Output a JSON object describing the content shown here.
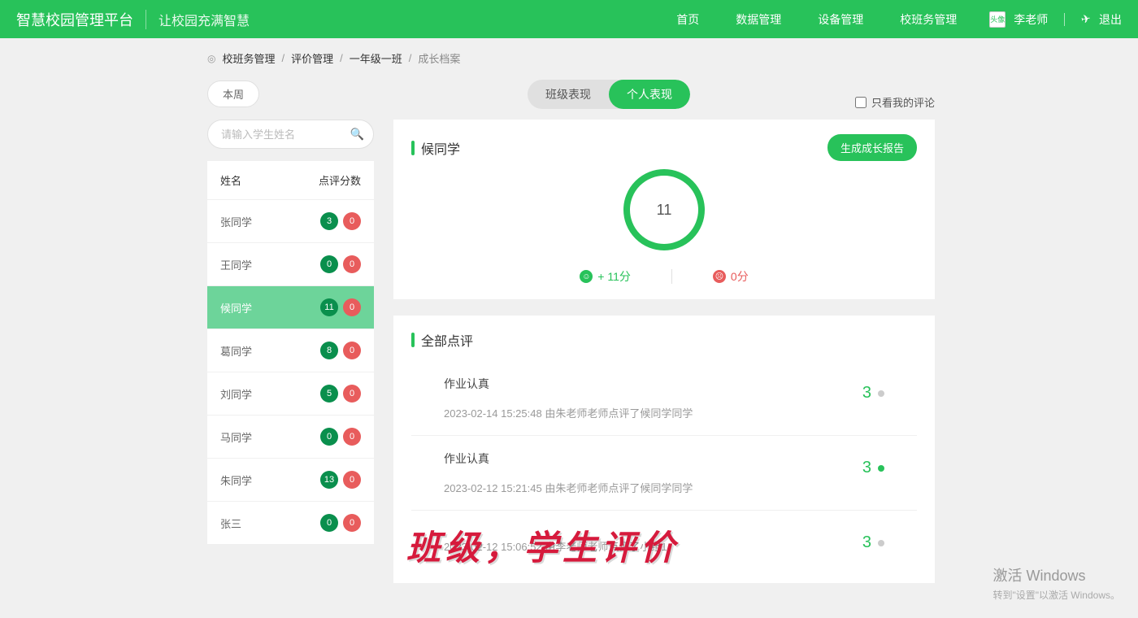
{
  "header": {
    "title": "智慧校园管理平台",
    "subtitle": "让校园充满智慧",
    "nav": {
      "home": "首页",
      "data": "数据管理",
      "device": "设备管理",
      "class": "校班务管理"
    },
    "avatar_alt": "头像",
    "username": "李老师",
    "logout": "退出"
  },
  "breadcrumb": {
    "b1": "校班务管理",
    "b2": "评价管理",
    "b3": "一年级一班",
    "b4": "成长档案"
  },
  "controls": {
    "week": "本周",
    "tab_class": "班级表现",
    "tab_person": "个人表现",
    "only_mine": "只看我的评论"
  },
  "search": {
    "placeholder": "请输入学生姓名"
  },
  "list_header": {
    "name": "姓名",
    "score": "点评分数"
  },
  "students": [
    {
      "name": "张同学",
      "pos": "3",
      "neg": "0"
    },
    {
      "name": "王同学",
      "pos": "0",
      "neg": "0"
    },
    {
      "name": "候同学",
      "pos": "11",
      "neg": "0"
    },
    {
      "name": "葛同学",
      "pos": "8",
      "neg": "0"
    },
    {
      "name": "刘同学",
      "pos": "5",
      "neg": "0"
    },
    {
      "name": "马同学",
      "pos": "0",
      "neg": "0"
    },
    {
      "name": "朱同学",
      "pos": "13",
      "neg": "0"
    },
    {
      "name": "张三",
      "pos": "0",
      "neg": "0"
    }
  ],
  "profile": {
    "name": "候同学",
    "report_btn": "生成成长报告",
    "ring_value": "11",
    "legend_pos": "+ 11分",
    "legend_neg": "0分"
  },
  "all_reviews": {
    "title": "全部点评",
    "items": [
      {
        "title": "作业认真",
        "meta": "2023-02-14 15:25:48 由朱老师老师点评了候同学同学",
        "score": "3",
        "green": false
      },
      {
        "title": "作业认真",
        "meta": "2023-02-12 15:21:45 由朱老师老师点评了候同学同学",
        "score": "3",
        "green": true
      },
      {
        "title": "",
        "meta": "2023-02-12 15:06:52 由李老师老师点评了小组1",
        "score": "3",
        "green": false
      }
    ]
  },
  "overlay": "班级，学生评价",
  "watermark": {
    "title": "激活 Windows",
    "sub": "转到\"设置\"以激活 Windows。"
  }
}
